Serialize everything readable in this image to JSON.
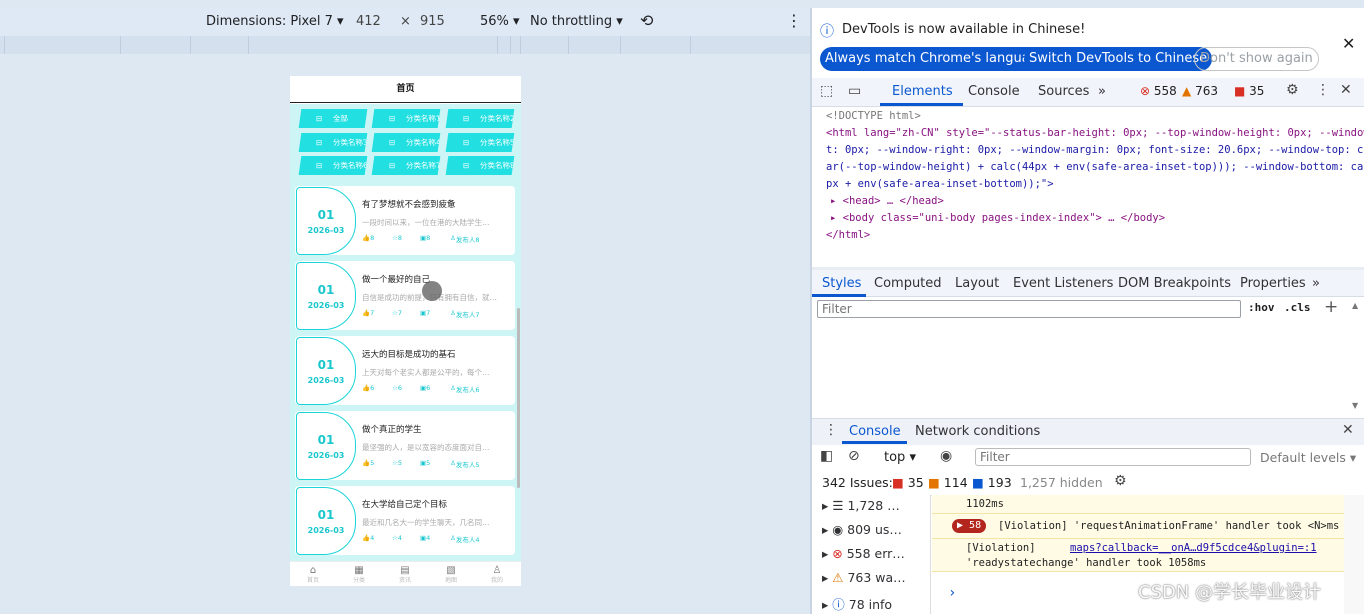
{
  "device_toolbar": {
    "dimensions_label": "Dimensions: Pixel 7",
    "width": "412",
    "times": "×",
    "height": "915",
    "zoom": "56%",
    "throttling": "No throttling"
  },
  "phone": {
    "title": "首页",
    "categories": [
      "全部",
      "分类名称1",
      "分类名称2",
      "分类名称3",
      "分类名称4",
      "分类名称5",
      "分类名称6",
      "分类名称7",
      "分类名称8"
    ],
    "posts": [
      {
        "day": "01",
        "month": "2026-03",
        "title": "有了梦想就不会感到疲惫",
        "desc": "一段时间以来，一位在港的大陆学生…",
        "likes": "8",
        "favs": "8",
        "views": "8",
        "author": "发布人8"
      },
      {
        "day": "01",
        "month": "2026-03",
        "title": "做一个最好的自己",
        "desc": "自信是成功的前提，只有拥有自信，就…",
        "likes": "7",
        "favs": "7",
        "views": "7",
        "author": "发布人7"
      },
      {
        "day": "01",
        "month": "2026-03",
        "title": "远大的目标是成功的基石",
        "desc": "上天对每个老实人都是公平的，每个…",
        "likes": "6",
        "favs": "6",
        "views": "6",
        "author": "发布人6"
      },
      {
        "day": "01",
        "month": "2026-03",
        "title": "做个真正的学生",
        "desc": "最坚强的人，是以宽容的态度面对自…",
        "likes": "5",
        "favs": "5",
        "views": "5",
        "author": "发布人5"
      },
      {
        "day": "01",
        "month": "2026-03",
        "title": "在大学给自己定个目标",
        "desc": "最近和几名大一的学生聊天，几名同…",
        "likes": "4",
        "favs": "4",
        "views": "4",
        "author": "发布人4"
      }
    ],
    "tabs": [
      "首页",
      "分类",
      "资讯",
      "地图",
      "我的"
    ],
    "accent": "#22dfe2"
  },
  "devtools": {
    "info_text": "DevTools is now available in Chinese!",
    "btn_match": "Always match Chrome's language",
    "btn_switch": "Switch DevTools to Chinese",
    "btn_dont": "Don't show again",
    "tabs": [
      "Elements",
      "Console",
      "Sources"
    ],
    "more": "»",
    "errors": "558",
    "warnings": "763",
    "issues": "35",
    "html_lines": [
      "<!DOCTYPE html>",
      "<html lang=\"zh-CN\" style=\"--status-bar-height: 0px; --top-window-height: 0px; --window-lef",
      "t: 0px; --window-right: 0px; --window-margin: 0px; font-size: 20.6px; --window-top: calc(v",
      "ar(--top-window-height) + calc(44px + env(safe-area-inset-top))); --window-bottom: calc(50",
      "px + env(safe-area-inset-bottom));\">",
      "<head> … </head>",
      "<body class=\"uni-body pages-index-index\"> … </body>",
      "</html>"
    ],
    "style_tabs": [
      "Styles",
      "Computed",
      "Layout",
      "Event Listeners",
      "DOM Breakpoints",
      "Properties"
    ],
    "filter_placeholder": "Filter",
    "hov": ":hov",
    "cls": ".cls",
    "plus": "+",
    "drawer_tabs": [
      "Console",
      "Network conditions"
    ],
    "context": "top",
    "console_filter": "Filter",
    "levels": "Default levels",
    "issues_label": "342 Issues:",
    "issue_err": "35",
    "issue_warn": "114",
    "issue_info": "193",
    "hidden": "1,257 hidden",
    "sidebar_items": [
      "1,728 …",
      "809 us…",
      "558 err…",
      "763 wa…",
      "78 info"
    ],
    "messages": {
      "m0": "1102ms",
      "m1_badge": "58",
      "m1_text": "[Violation] 'requestAnimationFrame' handler took <N>ms",
      "m2_text": "[Violation]",
      "m2_link": "maps?callback=__onA…d9f5cdce4&plugin=:1",
      "m2_text2": "'readystatechange' handler took 1058ms",
      "prompt": "›"
    }
  },
  "watermark": "CSDN @学长毕业设计"
}
